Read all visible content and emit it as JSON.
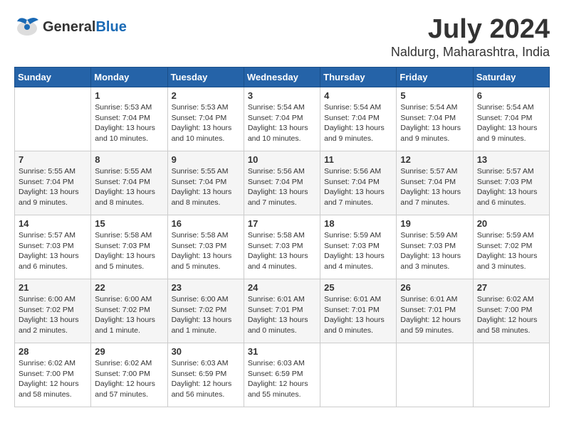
{
  "header": {
    "logo_general": "General",
    "logo_blue": "Blue",
    "month_year": "July 2024",
    "location": "Naldurg, Maharashtra, India"
  },
  "days_of_week": [
    "Sunday",
    "Monday",
    "Tuesday",
    "Wednesday",
    "Thursday",
    "Friday",
    "Saturday"
  ],
  "weeks": [
    [
      {
        "day": "",
        "info": ""
      },
      {
        "day": "1",
        "info": "Sunrise: 5:53 AM\nSunset: 7:04 PM\nDaylight: 13 hours\nand 10 minutes."
      },
      {
        "day": "2",
        "info": "Sunrise: 5:53 AM\nSunset: 7:04 PM\nDaylight: 13 hours\nand 10 minutes."
      },
      {
        "day": "3",
        "info": "Sunrise: 5:54 AM\nSunset: 7:04 PM\nDaylight: 13 hours\nand 10 minutes."
      },
      {
        "day": "4",
        "info": "Sunrise: 5:54 AM\nSunset: 7:04 PM\nDaylight: 13 hours\nand 9 minutes."
      },
      {
        "day": "5",
        "info": "Sunrise: 5:54 AM\nSunset: 7:04 PM\nDaylight: 13 hours\nand 9 minutes."
      },
      {
        "day": "6",
        "info": "Sunrise: 5:54 AM\nSunset: 7:04 PM\nDaylight: 13 hours\nand 9 minutes."
      }
    ],
    [
      {
        "day": "7",
        "info": "Sunrise: 5:55 AM\nSunset: 7:04 PM\nDaylight: 13 hours\nand 9 minutes."
      },
      {
        "day": "8",
        "info": "Sunrise: 5:55 AM\nSunset: 7:04 PM\nDaylight: 13 hours\nand 8 minutes."
      },
      {
        "day": "9",
        "info": "Sunrise: 5:55 AM\nSunset: 7:04 PM\nDaylight: 13 hours\nand 8 minutes."
      },
      {
        "day": "10",
        "info": "Sunrise: 5:56 AM\nSunset: 7:04 PM\nDaylight: 13 hours\nand 7 minutes."
      },
      {
        "day": "11",
        "info": "Sunrise: 5:56 AM\nSunset: 7:04 PM\nDaylight: 13 hours\nand 7 minutes."
      },
      {
        "day": "12",
        "info": "Sunrise: 5:57 AM\nSunset: 7:04 PM\nDaylight: 13 hours\nand 7 minutes."
      },
      {
        "day": "13",
        "info": "Sunrise: 5:57 AM\nSunset: 7:03 PM\nDaylight: 13 hours\nand 6 minutes."
      }
    ],
    [
      {
        "day": "14",
        "info": "Sunrise: 5:57 AM\nSunset: 7:03 PM\nDaylight: 13 hours\nand 6 minutes."
      },
      {
        "day": "15",
        "info": "Sunrise: 5:58 AM\nSunset: 7:03 PM\nDaylight: 13 hours\nand 5 minutes."
      },
      {
        "day": "16",
        "info": "Sunrise: 5:58 AM\nSunset: 7:03 PM\nDaylight: 13 hours\nand 5 minutes."
      },
      {
        "day": "17",
        "info": "Sunrise: 5:58 AM\nSunset: 7:03 PM\nDaylight: 13 hours\nand 4 minutes."
      },
      {
        "day": "18",
        "info": "Sunrise: 5:59 AM\nSunset: 7:03 PM\nDaylight: 13 hours\nand 4 minutes."
      },
      {
        "day": "19",
        "info": "Sunrise: 5:59 AM\nSunset: 7:03 PM\nDaylight: 13 hours\nand 3 minutes."
      },
      {
        "day": "20",
        "info": "Sunrise: 5:59 AM\nSunset: 7:02 PM\nDaylight: 13 hours\nand 3 minutes."
      }
    ],
    [
      {
        "day": "21",
        "info": "Sunrise: 6:00 AM\nSunset: 7:02 PM\nDaylight: 13 hours\nand 2 minutes."
      },
      {
        "day": "22",
        "info": "Sunrise: 6:00 AM\nSunset: 7:02 PM\nDaylight: 13 hours\nand 1 minute."
      },
      {
        "day": "23",
        "info": "Sunrise: 6:00 AM\nSunset: 7:02 PM\nDaylight: 13 hours\nand 1 minute."
      },
      {
        "day": "24",
        "info": "Sunrise: 6:01 AM\nSunset: 7:01 PM\nDaylight: 13 hours\nand 0 minutes."
      },
      {
        "day": "25",
        "info": "Sunrise: 6:01 AM\nSunset: 7:01 PM\nDaylight: 13 hours\nand 0 minutes."
      },
      {
        "day": "26",
        "info": "Sunrise: 6:01 AM\nSunset: 7:01 PM\nDaylight: 12 hours\nand 59 minutes."
      },
      {
        "day": "27",
        "info": "Sunrise: 6:02 AM\nSunset: 7:00 PM\nDaylight: 12 hours\nand 58 minutes."
      }
    ],
    [
      {
        "day": "28",
        "info": "Sunrise: 6:02 AM\nSunset: 7:00 PM\nDaylight: 12 hours\nand 58 minutes."
      },
      {
        "day": "29",
        "info": "Sunrise: 6:02 AM\nSunset: 7:00 PM\nDaylight: 12 hours\nand 57 minutes."
      },
      {
        "day": "30",
        "info": "Sunrise: 6:03 AM\nSunset: 6:59 PM\nDaylight: 12 hours\nand 56 minutes."
      },
      {
        "day": "31",
        "info": "Sunrise: 6:03 AM\nSunset: 6:59 PM\nDaylight: 12 hours\nand 55 minutes."
      },
      {
        "day": "",
        "info": ""
      },
      {
        "day": "",
        "info": ""
      },
      {
        "day": "",
        "info": ""
      }
    ]
  ]
}
